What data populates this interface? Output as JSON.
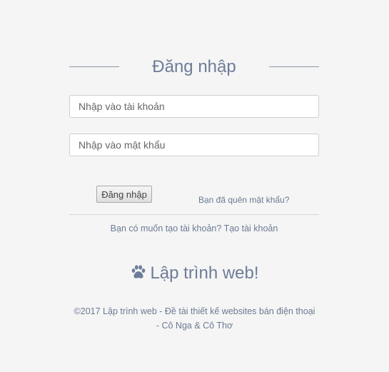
{
  "login": {
    "title": "Đăng nhập",
    "username_placeholder": "Nhập vào tài khoản",
    "password_placeholder": "Nhập vào mật khẩu",
    "submit_label": "Đăng nhập",
    "forgot_password": "Bạn đã quên mật khẩu?",
    "register_prompt": "Bạn có muốn tạo tài khoản?",
    "register_link": "Tạo tài khoản"
  },
  "brand": {
    "icon": "paw-icon",
    "name": "Lập trình web!"
  },
  "footer": {
    "text": "©2017 Lập trình web - Đề tài thiết kế websites bán điện thoại - Cô Nga & Cô Thơ"
  },
  "colors": {
    "background": "#f5f5f5",
    "text": "#6a7a93",
    "heading": "#6d7d98"
  }
}
